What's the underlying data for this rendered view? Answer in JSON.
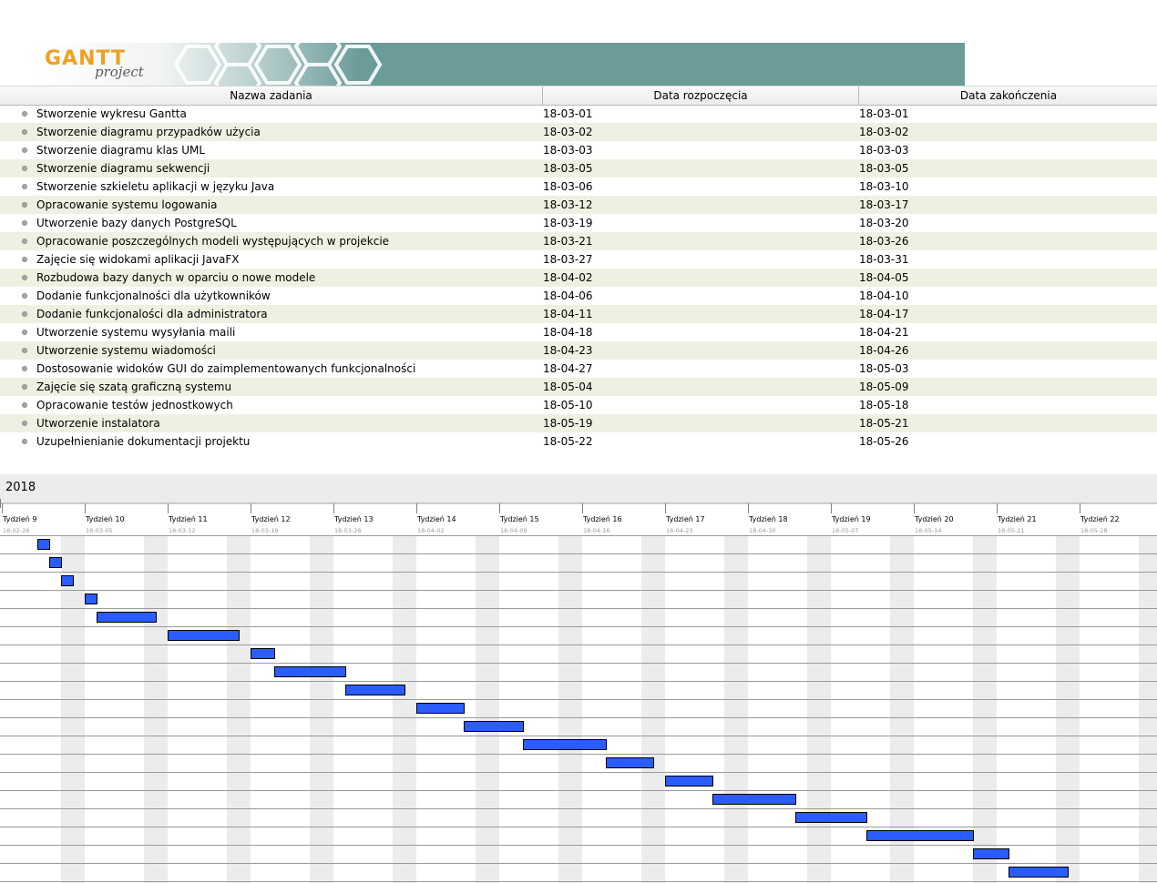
{
  "header": {
    "logo_main": "GANTT",
    "logo_sub": "project",
    "colors": {
      "banner": "#6b9c9a",
      "logo": "#f0a020",
      "bar": "#2b5cff"
    }
  },
  "table": {
    "columns": [
      "Nazwa zadania",
      "Data rozpoczęcia",
      "Data zakończenia"
    ],
    "rows": [
      {
        "name": "Stworzenie wykresu Gantta",
        "start": "18-03-01",
        "end": "18-03-01"
      },
      {
        "name": "Stworzenie diagramu przypadków użycia",
        "start": "18-03-02",
        "end": "18-03-02"
      },
      {
        "name": "Stworzenie diagramu klas UML",
        "start": "18-03-03",
        "end": "18-03-03"
      },
      {
        "name": "Stworzenie diagramu sekwencji",
        "start": "18-03-05",
        "end": "18-03-05"
      },
      {
        "name": "Stworzenie szkieletu aplikacji w języku Java",
        "start": "18-03-06",
        "end": "18-03-10"
      },
      {
        "name": "Opracowanie systemu logowania",
        "start": "18-03-12",
        "end": "18-03-17"
      },
      {
        "name": "Utworzenie bazy danych PostgreSQL",
        "start": "18-03-19",
        "end": "18-03-20"
      },
      {
        "name": "Opracowanie poszczególnych modeli występujących w projekcie",
        "start": "18-03-21",
        "end": "18-03-26"
      },
      {
        "name": "Zajęcie się widokami aplikacji JavaFX",
        "start": "18-03-27",
        "end": "18-03-31"
      },
      {
        "name": "Rozbudowa bazy danych w oparciu o nowe modele",
        "start": "18-04-02",
        "end": "18-04-05"
      },
      {
        "name": "Dodanie funkcjonalności dla użytkowników",
        "start": "18-04-06",
        "end": "18-04-10"
      },
      {
        "name": "Dodanie funkcjonalości dla administratora",
        "start": "18-04-11",
        "end": "18-04-17"
      },
      {
        "name": "Utworzenie systemu wysyłania maili",
        "start": "18-04-18",
        "end": "18-04-21"
      },
      {
        "name": "Utworzenie systemu wiadomości",
        "start": "18-04-23",
        "end": "18-04-26"
      },
      {
        "name": "Dostosowanie widoków GUI do zaimplementowanych funkcjonalności",
        "start": "18-04-27",
        "end": "18-05-03"
      },
      {
        "name": "Zajęcie się szatą graficzną systemu",
        "start": "18-05-04",
        "end": "18-05-09"
      },
      {
        "name": "Opracowanie testów jednostkowych",
        "start": "18-05-10",
        "end": "18-05-18"
      },
      {
        "name": "Utworzenie instalatora",
        "start": "18-05-19",
        "end": "18-05-21"
      },
      {
        "name": "Uzupełnienianie dokumentacji projektu",
        "start": "18-05-22",
        "end": "18-05-26"
      }
    ]
  },
  "chart_data": {
    "type": "gantt",
    "year_label": "2018",
    "weeks": [
      {
        "label": "Tydzień 9",
        "date": "18-02-26"
      },
      {
        "label": "Tydzień 10",
        "date": "18-03-05"
      },
      {
        "label": "Tydzień 11",
        "date": "18-03-12"
      },
      {
        "label": "Tydzień 12",
        "date": "18-03-19"
      },
      {
        "label": "Tydzień 13",
        "date": "18-03-26"
      },
      {
        "label": "Tydzień 14",
        "date": "18-04-02"
      },
      {
        "label": "Tydzień 15",
        "date": "18-04-09"
      },
      {
        "label": "Tydzień 16",
        "date": "18-04-16"
      },
      {
        "label": "Tydzień 17",
        "date": "18-04-23"
      },
      {
        "label": "Tydzień 18",
        "date": "18-04-30"
      },
      {
        "label": "Tydzień 19",
        "date": "18-05-07"
      },
      {
        "label": "Tydzień 20",
        "date": "18-05-14"
      },
      {
        "label": "Tydzień 21",
        "date": "18-05-21"
      },
      {
        "label": "Tydzień 22",
        "date": "18-05-28"
      }
    ],
    "tasks": [
      {
        "start": "2018-03-01",
        "end": "2018-03-01"
      },
      {
        "start": "2018-03-02",
        "end": "2018-03-02"
      },
      {
        "start": "2018-03-03",
        "end": "2018-03-03"
      },
      {
        "start": "2018-03-05",
        "end": "2018-03-05"
      },
      {
        "start": "2018-03-06",
        "end": "2018-03-10"
      },
      {
        "start": "2018-03-12",
        "end": "2018-03-17"
      },
      {
        "start": "2018-03-19",
        "end": "2018-03-20"
      },
      {
        "start": "2018-03-21",
        "end": "2018-03-26"
      },
      {
        "start": "2018-03-27",
        "end": "2018-03-31"
      },
      {
        "start": "2018-04-02",
        "end": "2018-04-05"
      },
      {
        "start": "2018-04-06",
        "end": "2018-04-10"
      },
      {
        "start": "2018-04-11",
        "end": "2018-04-17"
      },
      {
        "start": "2018-04-18",
        "end": "2018-04-21"
      },
      {
        "start": "2018-04-23",
        "end": "2018-04-26"
      },
      {
        "start": "2018-04-27",
        "end": "2018-05-03"
      },
      {
        "start": "2018-05-04",
        "end": "2018-05-09"
      },
      {
        "start": "2018-05-10",
        "end": "2018-05-18"
      },
      {
        "start": "2018-05-19",
        "end": "2018-05-21"
      },
      {
        "start": "2018-05-22",
        "end": "2018-05-26"
      }
    ],
    "weekend_shading": true
  }
}
